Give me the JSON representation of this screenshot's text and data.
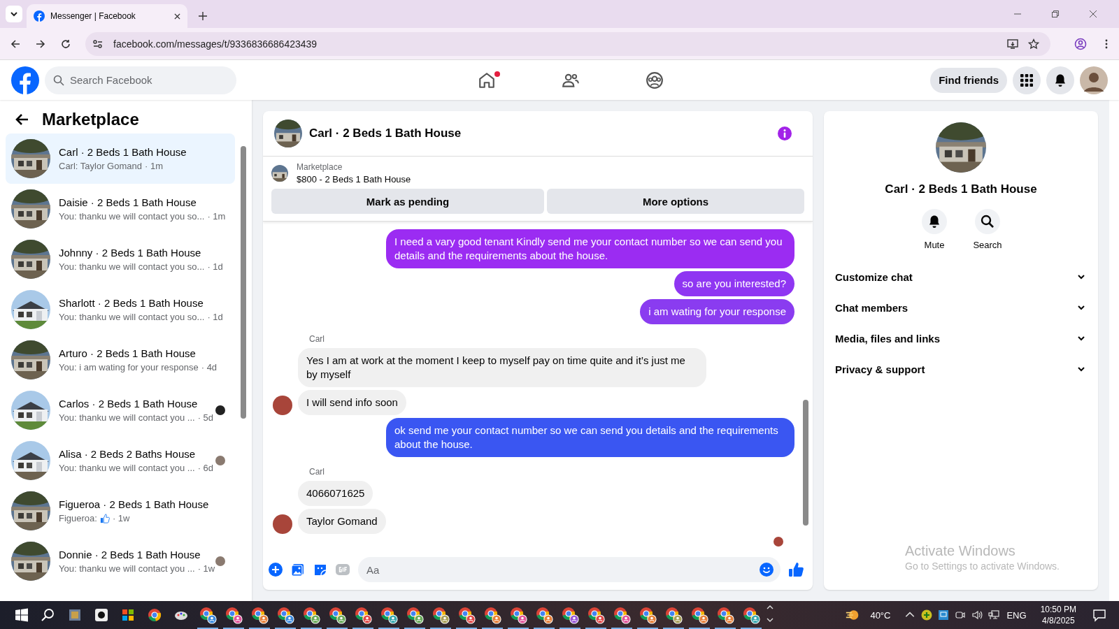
{
  "browser": {
    "tab_title": "Messenger | Facebook",
    "url": "facebook.com/messages/t/9336836686423439"
  },
  "header": {
    "search_placeholder": "Search Facebook",
    "nav": [
      {
        "kind": "home",
        "dot": true
      },
      {
        "kind": "friends",
        "dot": false
      },
      {
        "kind": "groups",
        "dot": false
      }
    ],
    "find_friends": "Find friends"
  },
  "sidebar": {
    "title": "Marketplace",
    "chats": [
      {
        "name": "Carl · 2 Beds 1 Bath House",
        "preview": "Carl: Taylor Gomand",
        "like": false,
        "time": "· 1m",
        "selected": true,
        "seen": false
      },
      {
        "name": "Daisie · 2 Beds 1 Bath House",
        "preview": "You: thanku we will contact you so...",
        "like": false,
        "time": "· 1m",
        "selected": false,
        "seen": false
      },
      {
        "name": "Johnny · 2 Beds 1 Bath House",
        "preview": "You: thanku we will contact you so...",
        "like": false,
        "time": "· 1d",
        "selected": false,
        "seen": false
      },
      {
        "name": "Sharlott · 2 Beds 1 Bath House",
        "preview": "You: thanku we will contact you so...",
        "like": false,
        "time": "· 1d",
        "selected": false,
        "seen": false
      },
      {
        "name": "Arturo · 2 Beds 1 Bath House",
        "preview": "You: i am wating for your response",
        "like": false,
        "time": "· 4d",
        "selected": false,
        "seen": false
      },
      {
        "name": "Carlos · 2 Beds 1 Bath House",
        "preview": "You: thanku we will contact you ...",
        "like": false,
        "time": "· 5d",
        "selected": false,
        "seen": true
      },
      {
        "name": "Alisa · 2 Beds 2 Baths House",
        "preview": "You: thanku we will contact you ...",
        "like": false,
        "time": "· 6d",
        "selected": false,
        "seen": true
      },
      {
        "name": "Figueroa · 2 Beds 1 Bath House",
        "preview": "Figueroa:",
        "like": true,
        "time": "· 1w",
        "selected": false,
        "seen": false
      },
      {
        "name": "Donnie · 2 Beds 1 Bath House",
        "preview": "You: thanku we will contact you ...",
        "like": false,
        "time": "· 1w",
        "selected": false,
        "seen": true
      }
    ]
  },
  "chat": {
    "title": "Carl · 2 Beds 1 Bath House",
    "listing": {
      "label": "Marketplace",
      "price_title": "$800 - 2 Beds 1 Bath House"
    },
    "buttons": [
      "Mark as pending",
      "More options"
    ],
    "messages": [
      {
        "kind": "out",
        "text": "I need a vary good tenant Kindly send me your contact number so we can send you details and the requirements about the house.",
        "color": "#9b2cf2"
      },
      {
        "kind": "out",
        "text": "so  are you interested?",
        "color": "#8f36f2"
      },
      {
        "kind": "out",
        "text": "i am wating for your response",
        "color": "#8a3cf0"
      },
      {
        "kind": "name",
        "text": "Carl"
      },
      {
        "kind": "in",
        "text": "Yes I am at work at the moment I keep to myself pay on time quite and it’s just me by myself",
        "avatar": false
      },
      {
        "kind": "in",
        "text": "I will send info soon",
        "avatar": true
      },
      {
        "kind": "out",
        "text": "ok send me your contact number so we can send you details and the requirements about the house.",
        "color": "#3a56f2"
      },
      {
        "kind": "name",
        "text": "Carl"
      },
      {
        "kind": "in",
        "text": "4066071625",
        "avatar": false
      },
      {
        "kind": "in",
        "text": "Taylor Gomand",
        "avatar": true
      }
    ],
    "composer": {
      "placeholder": "Aa"
    }
  },
  "details": {
    "title": "Carl · 2 Beds 1 Bath House",
    "actions": [
      {
        "kind": "mute",
        "label": "Mute"
      },
      {
        "kind": "search",
        "label": "Search"
      }
    ],
    "sections": [
      {
        "label": "Customize chat",
        "expanded": false
      },
      {
        "label": "Chat members",
        "expanded": false
      },
      {
        "label": "Media, files and links",
        "expanded": false
      },
      {
        "label": "Privacy & support",
        "expanded": false
      }
    ]
  },
  "watermark": {
    "title": "Activate Windows",
    "text": "Go to Settings to activate Windows."
  },
  "taskbar": {
    "apps": [
      {
        "color": "#3c8ce0"
      },
      {
        "color": "#e0559a"
      },
      {
        "color": "#e5803a"
      },
      {
        "color": "#3c8ce0"
      },
      {
        "color": "#6aab5a"
      },
      {
        "color": "#6aab5a"
      },
      {
        "color": "#e04a4a"
      },
      {
        "color": "#3aa8b0"
      },
      {
        "color": "#6aab5a"
      },
      {
        "color": "#a8a05a"
      },
      {
        "color": "#e04a4a"
      },
      {
        "color": "#e5803a"
      },
      {
        "color": "#e0559a"
      },
      {
        "color": "#e5803a"
      },
      {
        "color": "#9a5ad8"
      },
      {
        "color": "#e04a4a"
      },
      {
        "color": "#e0559a"
      },
      {
        "color": "#e5803a"
      },
      {
        "color": "#a8a05a"
      },
      {
        "color": "#e5803a"
      },
      {
        "color": "#e5803a"
      },
      {
        "color": "#3aa8b0"
      }
    ],
    "weather": "40°C",
    "language": "ENG",
    "time": "10:50 PM",
    "date": "4/8/2025"
  }
}
